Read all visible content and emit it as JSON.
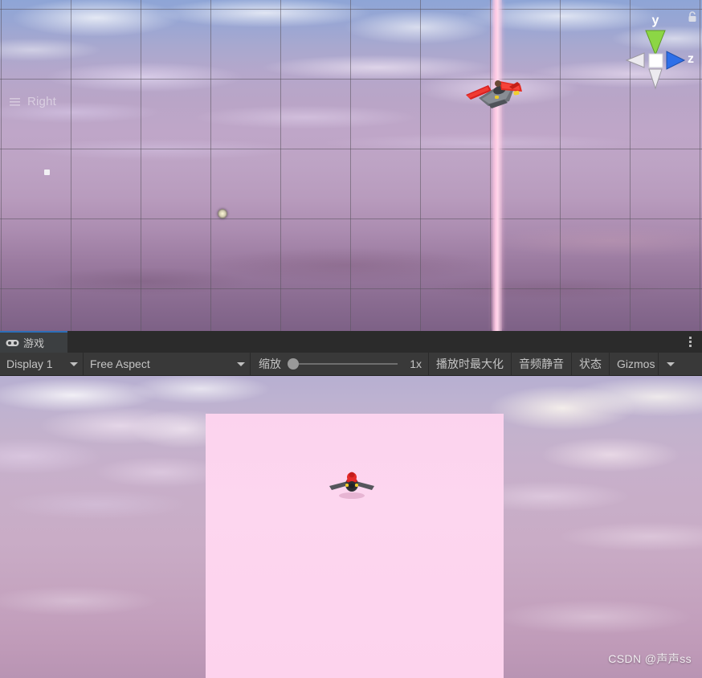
{
  "window": {
    "scene_view": {
      "view_gizmo": {
        "axis_y_label": "y",
        "axis_z_label": "z",
        "view_name": "Right",
        "lock_icon": "lock-open-icon",
        "perspective_icon": "perspective-lines-icon"
      },
      "objects": {
        "airplane_label": "airplane-model",
        "light_gizmo_label": "light-gizmo",
        "marker_label": "scene-marker",
        "beam_label": "pink-plane-edge"
      }
    },
    "tab": {
      "label": "游戏",
      "icon": "gamepad-icon",
      "panel_menu_icon": "kebab-menu-icon"
    },
    "toolbar": {
      "display": {
        "value": "Display 1",
        "caret_icon": "chevron-down-icon"
      },
      "aspect": {
        "value": "Free Aspect",
        "caret_icon": "chevron-down-icon"
      },
      "zoom": {
        "label": "缩放",
        "value": "1x",
        "slider_position_pct": 0
      },
      "maximize_on_play": "播放时最大化",
      "mute_audio": "音频静音",
      "stats": "状态",
      "gizmos": {
        "label": "Gizmos",
        "caret_icon": "chevron-down-icon"
      }
    },
    "game_view": {
      "watermark": "CSDN @声声ss",
      "pink_plane_label": "pink-quad",
      "airplane_label": "airplane-model"
    },
    "colors": {
      "accent_tab": "#2c6fb8",
      "toolbar_bg": "#393939",
      "tab_strip_bg": "#2b2b2b",
      "tab_active_bg": "#3c3f41",
      "text": "#c4c4c4",
      "axis_y": "#8cd645",
      "axis_z": "#2e6fe8",
      "axis_x": "#e8e8e8",
      "pink_quad": "#fcd3ee",
      "beam_pink": "#ffc9e4",
      "plane_red": "#e02424"
    }
  }
}
